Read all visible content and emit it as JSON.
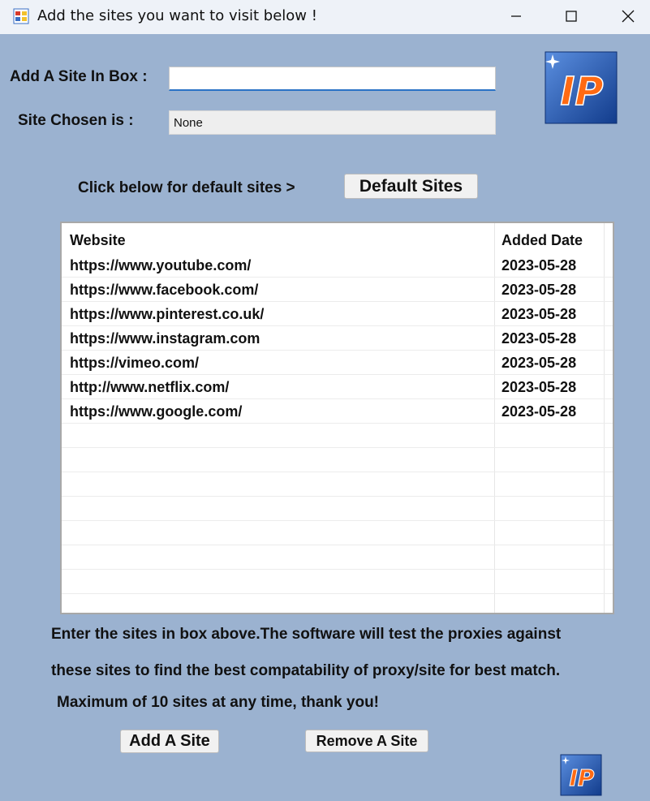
{
  "window": {
    "title": "Add the sites you want to visit below !"
  },
  "form": {
    "add_label": "Add A Site In Box :",
    "add_input_value": "",
    "chosen_label": "Site Chosen is :",
    "chosen_value": "None",
    "default_prompt": "Click below for default sites >",
    "default_button": "Default Sites"
  },
  "logo": {
    "text": "IP"
  },
  "grid": {
    "columns": [
      "Website",
      "Added Date"
    ],
    "rows": [
      {
        "website": "https://www.youtube.com/",
        "date": "2023-05-28"
      },
      {
        "website": "https://www.facebook.com/",
        "date": "2023-05-28"
      },
      {
        "website": "https://www.pinterest.co.uk/",
        "date": "2023-05-28"
      },
      {
        "website": "https://www.instagram.com",
        "date": "2023-05-28"
      },
      {
        "website": "https://vimeo.com/",
        "date": "2023-05-28"
      },
      {
        "website": "http://www.netflix.com/",
        "date": "2023-05-28"
      },
      {
        "website": "https://www.google.com/",
        "date": "2023-05-28"
      }
    ]
  },
  "info": {
    "line1": "Enter the sites in box above.The software will test the proxies against",
    "line2": "these sites to find the best compatability of proxy/site for best match.",
    "line3": "Maximum of 10 sites at any time, thank you!"
  },
  "buttons": {
    "add": "Add A Site",
    "remove": "Remove A Site"
  },
  "colors": {
    "window_bg": "#9bb2d0",
    "logo_blue": "#1f4fa8",
    "logo_orange": "#ff6a13"
  }
}
